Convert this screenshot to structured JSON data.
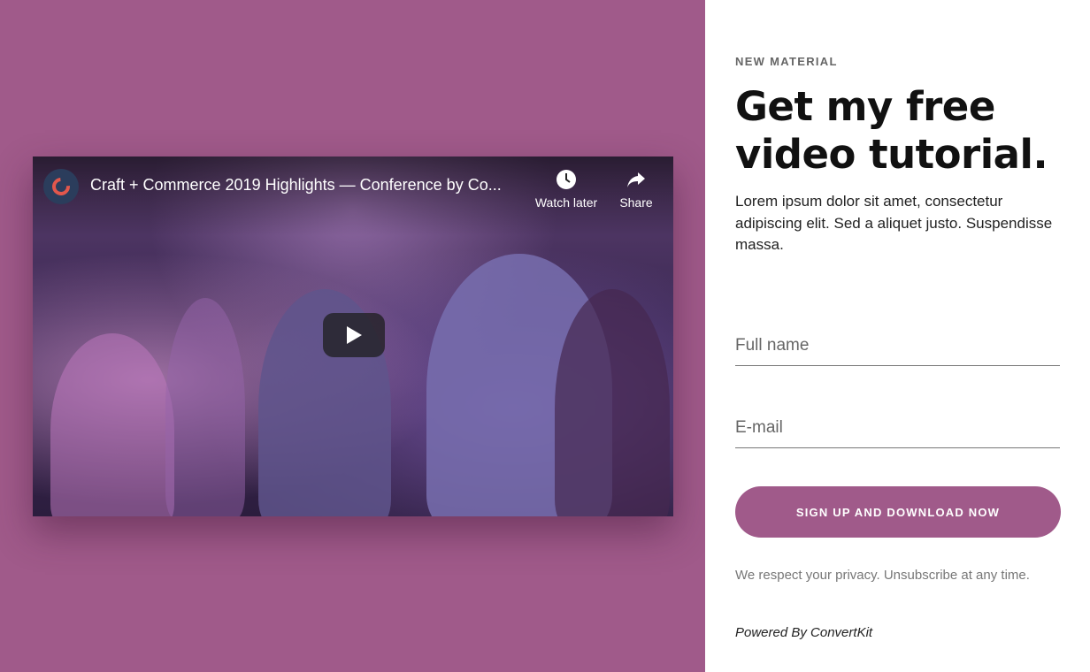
{
  "video": {
    "title": "Craft + Commerce 2019 Highlights — Conference by Co...",
    "watch_later_label": "Watch later",
    "share_label": "Share"
  },
  "form": {
    "eyebrow": "NEW MATERIAL",
    "headline": "Get my free video tutorial.",
    "description": "Lorem ipsum dolor sit amet, consectetur adipiscing elit. Sed a aliquet justo. Suspendisse massa.",
    "name_placeholder": "Full name",
    "email_placeholder": "E-mail",
    "submit_label": "SIGN UP AND DOWNLOAD NOW",
    "privacy_note": "We respect your privacy. Unsubscribe at any time.",
    "powered_by": "Powered By ConvertKit"
  },
  "colors": {
    "brand": "#a05a8a",
    "panel": "#ffffff",
    "text": "#111111"
  }
}
